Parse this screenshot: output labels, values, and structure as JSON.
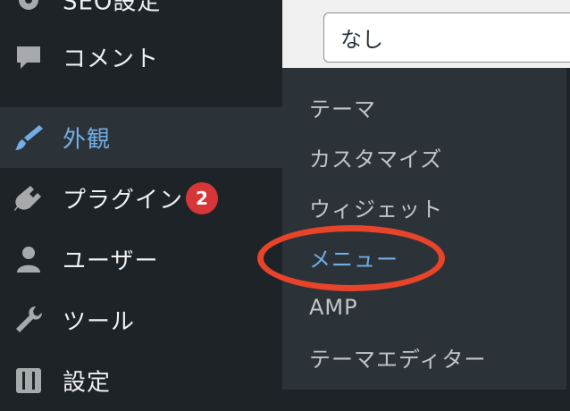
{
  "sidebar": {
    "items": [
      {
        "label": "SEO設定",
        "icon": "gear-icon"
      },
      {
        "label": "コメント",
        "icon": "comment-icon"
      },
      {
        "label": "外観",
        "icon": "paintbrush-icon"
      },
      {
        "label": "プラグイン",
        "icon": "plugin-icon",
        "badge": "2"
      },
      {
        "label": "ユーザー",
        "icon": "user-icon"
      },
      {
        "label": "ツール",
        "icon": "wrench-icon"
      },
      {
        "label": "設定",
        "icon": "settings-sliders-icon"
      }
    ]
  },
  "content": {
    "select_value": "なし"
  },
  "submenu": {
    "items": [
      {
        "label": "テーマ"
      },
      {
        "label": "カスタマイズ"
      },
      {
        "label": "ウィジェット"
      },
      {
        "label": "メニュー",
        "current": true
      },
      {
        "label": "AMP"
      },
      {
        "label": "テーマエディター"
      }
    ]
  },
  "colors": {
    "sidebar_bg": "#1d2327",
    "submenu_bg": "#2c3338",
    "accent": "#72aee6",
    "badge": "#d63638",
    "annotation_ring": "#e8442a"
  }
}
